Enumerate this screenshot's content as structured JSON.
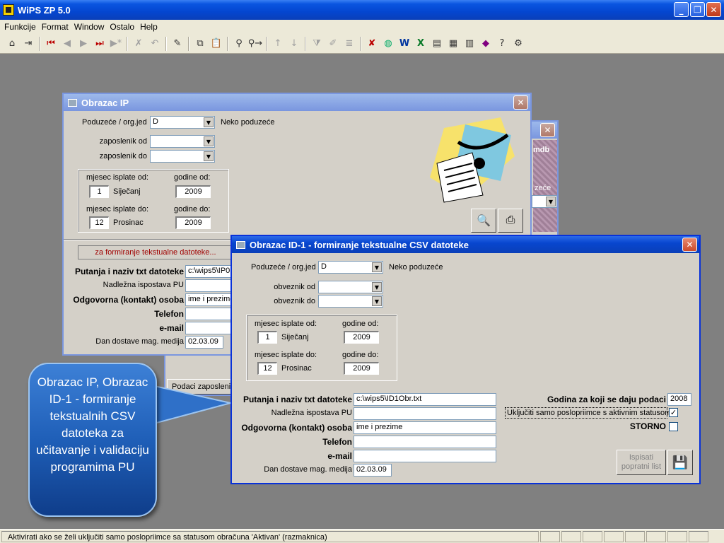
{
  "app": {
    "title": "WiPS ZP 5.0"
  },
  "menu": [
    {
      "label": "Funkcije"
    },
    {
      "label": "Format"
    },
    {
      "label": "Window"
    },
    {
      "label": "Ostalo"
    },
    {
      "label": "Help"
    }
  ],
  "toolbar": {
    "buttons": [
      "home-icon",
      "exit-icon",
      "first-record-icon",
      "previous-record-icon",
      "next-record-icon",
      "last-record-icon",
      "new-record-icon",
      "delete-record-icon",
      "undo-icon",
      "save-icon",
      "copy-icon",
      "paste-icon",
      "find-icon",
      "find-next-icon",
      "sort-ascending-icon",
      "sort-descending-icon",
      "filter-icon",
      "edit-filter-icon",
      "apply-filter-icon",
      "remove-filter-icon",
      "globe-icon",
      "word-icon",
      "excel-icon",
      "report-icon",
      "print-preview-icon",
      "book-icon",
      "library-icon",
      "help-icon",
      "settings-icon"
    ]
  },
  "win_ip": {
    "title": "Obrazac IP",
    "poduzece_label": "Poduzeće / org.jed",
    "poduzece_value": "D",
    "poduzece_name": "Neko poduzeće",
    "zaposlenik_od_label": "zaposlenik od",
    "zaposlenik_do_label": "zaposlenik do",
    "mjesec_od_label": "mjesec isplate od:",
    "godine_od_label": "godine od:",
    "mjesec_od_value": "1",
    "mjesec_od_name": "Siječanj",
    "godine_od_value": "2009",
    "mjesec_do_label": "mjesec isplate do:",
    "godine_do_label": "godine do:",
    "mjesec_do_value": "12",
    "mjesec_do_name": "Prosinac",
    "godine_do_value": "2009",
    "csv_banner": "za formiranje tekstualne datoteke...",
    "putanja_label": "Putanja i naziv txt datoteke",
    "putanja_value": "c:\\wips5\\IP0",
    "ispostava_label": "Nadležna ispostava PU",
    "osoba_label": "Odgovorna (kontakt) osoba",
    "osoba_value": "ime i prezime",
    "telefon_label": "Telefon",
    "email_label": "e-mail",
    "dan_label": "Dan dostave mag. medija",
    "dan_value": "02.03.09"
  },
  "win_bg": {
    "mdb_text": "mdb",
    "partial_text": "zeće",
    "podaci_button": "Podaci zaposlenik"
  },
  "win_id1": {
    "title": "Obrazac ID-1 - formiranje tekstualne CSV datoteke",
    "poduzece_label": "Poduzeće / org.jed",
    "poduzece_value": "D",
    "poduzece_name": "Neko poduzeće",
    "obveznik_od_label": "obveznik od",
    "obveznik_do_label": "obveznik do",
    "mjesec_od_label": "mjesec isplate od:",
    "godine_od_label": "godine od:",
    "mjesec_od_value": "1",
    "mjesec_od_name": "Siječanj",
    "godine_od_value": "2009",
    "mjesec_do_label": "mjesec isplate do:",
    "godine_do_label": "godine do:",
    "mjesec_do_value": "12",
    "mjesec_do_name": "Prosinac",
    "godine_do_value": "2009",
    "putanja_label": "Putanja i naziv txt datoteke",
    "putanja_value": "c:\\wips5\\ID1Obr.txt",
    "ispostava_label": "Nadležna ispostava PU",
    "osoba_label": "Odgovorna (kontakt) osoba",
    "osoba_value": "ime i prezime",
    "telefon_label": "Telefon",
    "email_label": "e-mail",
    "dan_label": "Dan dostave mag. medija",
    "dan_value": "02.03.09",
    "godina_label": "Godina za koji se daju podaci",
    "godina_value": "2008",
    "ukljuciti_label": "Uključiti samo poslopriimce s aktivnim statusom",
    "ukljuciti_checked": "✓",
    "storno_label": "STORNO",
    "ispisati_label": "Ispisati popratni list"
  },
  "callout": {
    "text": "Obrazac IP, Obrazac ID-1 - formiranje tekstualnih CSV datoteka za učitavanje i validaciju programima PU"
  },
  "status": {
    "text": "Aktivirati ako se želi uključiti samo poslopriimce sa statusom obračuna 'Aktivan' (razmaknica)"
  }
}
